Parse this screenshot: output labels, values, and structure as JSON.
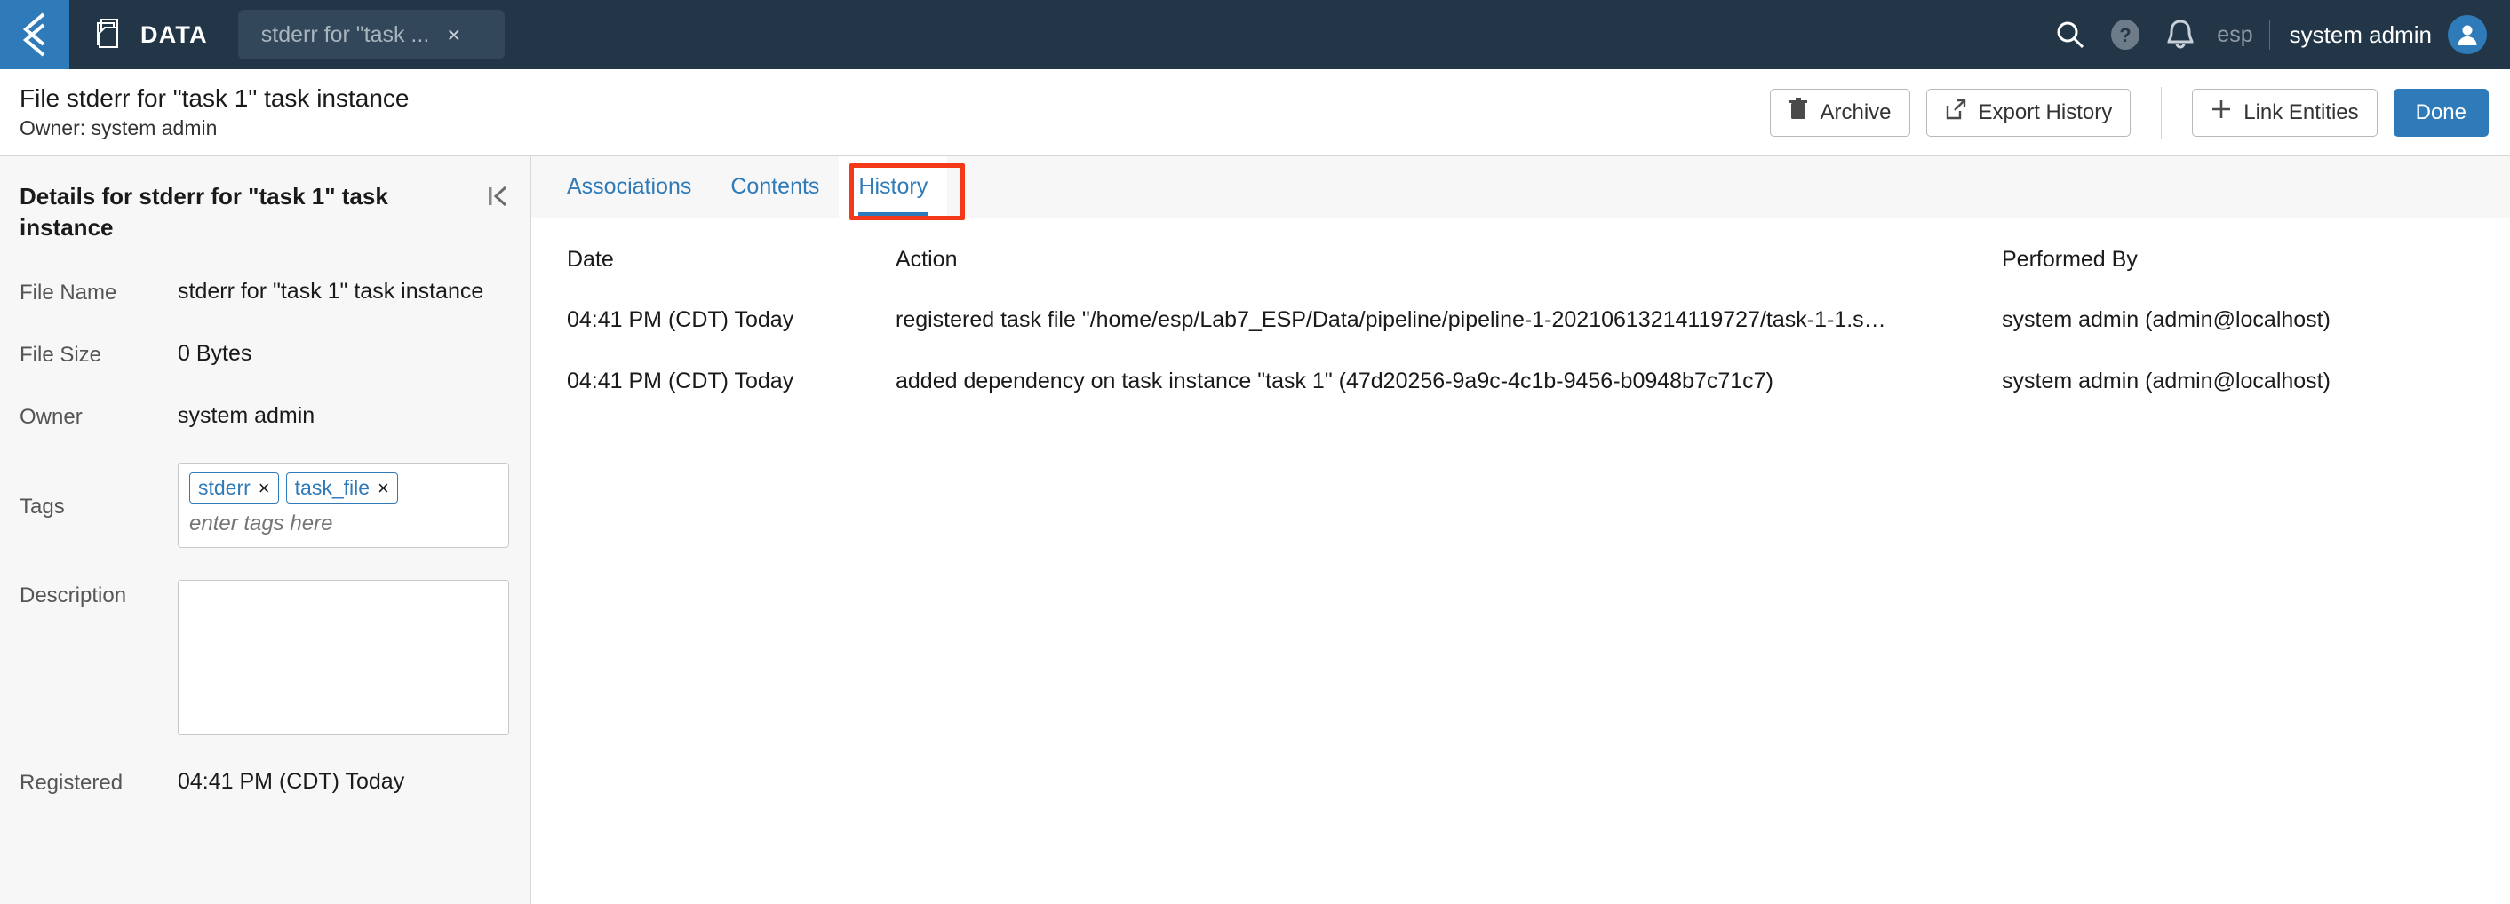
{
  "topnav": {
    "back_icon": "back-chevron-icon",
    "app_icon": "documents-icon",
    "app_label": "DATA",
    "tab": {
      "label": "stderr for \"task ...",
      "close_label": "×"
    },
    "icons": [
      {
        "name": "search-icon"
      },
      {
        "name": "help-icon"
      },
      {
        "name": "notifications-bell-icon"
      }
    ],
    "org": "esp",
    "separator": "|",
    "username": "system admin",
    "avatar_icon": "user-avatar-icon"
  },
  "page_header": {
    "title": "File stderr for \"task 1\" task instance",
    "subtitle": "Owner: system admin",
    "buttons": [
      {
        "name": "archive-button",
        "icon": "trash-icon",
        "label": "Archive"
      },
      {
        "name": "export-history-button",
        "icon": "external-link-icon",
        "label": "Export History"
      },
      {
        "name": "link-entities-button",
        "icon": "plus-icon",
        "label": "Link Entities"
      },
      {
        "name": "done-button",
        "icon": "",
        "label": "Done"
      }
    ]
  },
  "sidebar": {
    "title": "Details for stderr for \"task 1\" task instance",
    "collapse_icon": "collapse-panel-icon",
    "fields": [
      {
        "label": "File Name",
        "value": "stderr for \"task 1\" task instance"
      },
      {
        "label": "File Size",
        "value": "0 Bytes"
      },
      {
        "label": "Owner",
        "value": "system admin"
      }
    ],
    "tags": {
      "label": "Tags",
      "chips": [
        "stderr",
        "task_file"
      ],
      "chip_remove_label": "×",
      "placeholder": "enter tags here",
      "value": ""
    },
    "description": {
      "label": "Description",
      "value": "",
      "placeholder": ""
    },
    "registered": {
      "label": "Registered",
      "value": "04:41 PM (CDT) Today"
    }
  },
  "tabs": {
    "items": [
      {
        "label": "Associations",
        "active": false
      },
      {
        "label": "Contents",
        "active": false
      },
      {
        "label": "History",
        "active": true
      }
    ],
    "highlight_color": "#f4381a",
    "active_color": "#2f7ab8"
  },
  "history_table": {
    "columns": [
      "Date",
      "Action",
      "Performed By"
    ],
    "rows": [
      {
        "date": "04:41 PM (CDT) Today",
        "action": "registered task file \"/home/esp/Lab7_ESP/Data/pipeline/pipeline-1-20210613214119727/task-1-1.s…",
        "performed_by": "system admin (admin@localhost)"
      },
      {
        "date": "04:41 PM (CDT) Today",
        "action": "added dependency on task instance \"task 1\" (47d20256-9a9c-4c1b-9456-b0948b7c71c7)",
        "performed_by": "system admin (admin@localhost)"
      }
    ]
  },
  "colors": {
    "nav_bg": "#233648",
    "accent_blue": "#2f7ab8",
    "panel_bg": "#f7f7f7",
    "highlight_red": "#f4381a"
  }
}
